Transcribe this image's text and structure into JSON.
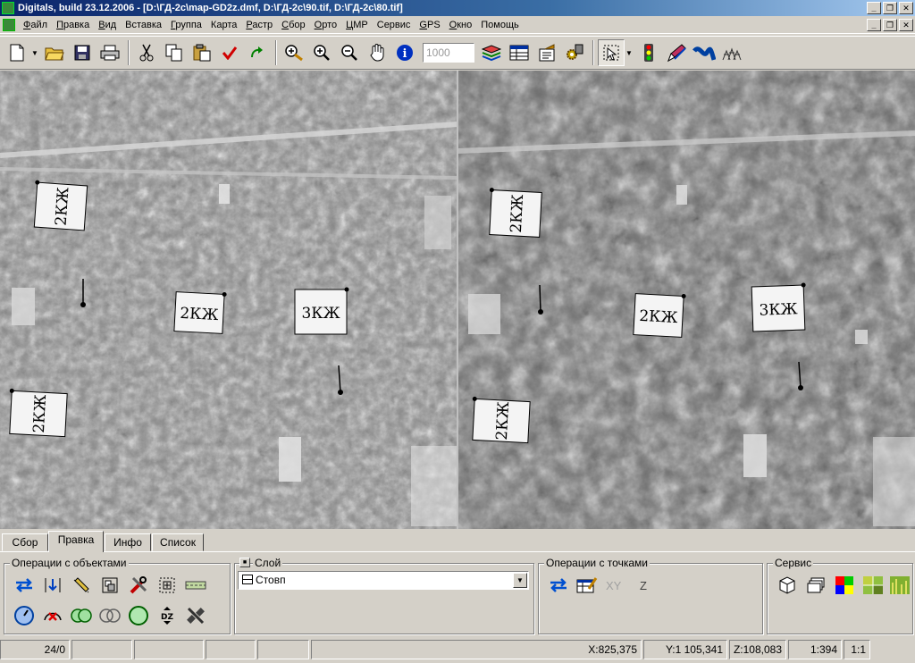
{
  "window": {
    "title": "Digitals, build 23.12.2006 - [D:\\ГД-2с\\map-GD2z.dmf, D:\\ГД-2с\\90.tif, D:\\ГД-2с\\80.tif]",
    "minimize_glyph": "_",
    "restore_glyph": "❐",
    "close_glyph": "✕"
  },
  "menu": {
    "items": [
      {
        "u": "Ф",
        "rest": "айл"
      },
      {
        "u": "П",
        "rest": "равка"
      },
      {
        "u": "В",
        "rest": "ид"
      },
      {
        "u": "",
        "rest": "Вставка"
      },
      {
        "u": "Г",
        "rest": "руппа"
      },
      {
        "u": "",
        "rest": "Карта"
      },
      {
        "u": "Р",
        "rest": "астр"
      },
      {
        "u": "С",
        "rest": "бор"
      },
      {
        "u": "О",
        "rest": "рто"
      },
      {
        "u": "Ц",
        "rest": "МР"
      },
      {
        "u": "",
        "rest": "Сервис"
      },
      {
        "u": "G",
        "rest": "PS"
      },
      {
        "u": "О",
        "rest": "кно"
      },
      {
        "u": "",
        "rest": "Помощь"
      }
    ]
  },
  "toolbar": {
    "scale_value": "1000",
    "icons": [
      "new-file-icon",
      "open-folder-icon",
      "save-icon",
      "print-icon",
      "cut-icon",
      "copy-icon",
      "paste-icon",
      "check-icon",
      "redo-icon",
      "add-raster-icon",
      "zoom-in-icon",
      "zoom-out-icon",
      "pan-hand-icon",
      "info-icon",
      "layers-icon",
      "table-icon",
      "properties-icon",
      "settings-icon",
      "select-pointer-icon",
      "traffic-light-icon",
      "pencil-icon",
      "curve-icon",
      "forest-icon"
    ]
  },
  "map": {
    "labels_left": [
      "2КЖ",
      "2КЖ",
      "3КЖ",
      "2КЖ"
    ],
    "labels_right": [
      "2КЖ",
      "2КЖ",
      "3КЖ",
      "2КЖ"
    ]
  },
  "tabs": [
    {
      "label": "Сбор",
      "active": false
    },
    {
      "label": "Правка",
      "active": true
    },
    {
      "label": "Инфо",
      "active": false
    },
    {
      "label": "Список",
      "active": false
    }
  ],
  "panel": {
    "objects_group": "Операции с объектами",
    "layer_group": "Слой",
    "layer_value": "Стовп",
    "points_group": "Операции с точками",
    "points_xy": "XY",
    "points_z": "Z",
    "service_group": "Сервис"
  },
  "status": {
    "count": "24/0",
    "x": "X:825,375",
    "y": "Y:1 105,341",
    "z": "Z:108,083",
    "scale": "1:394",
    "zoom": "1:1"
  },
  "colors": {
    "title_gradient_start": "#0a246a",
    "title_gradient_end": "#a6caf0",
    "face": "#d4d0c8"
  }
}
